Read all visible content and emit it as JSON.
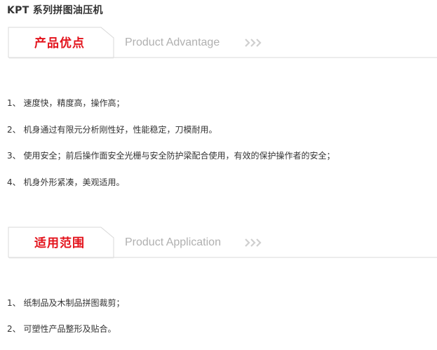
{
  "page": {
    "title": "KPT 系列拼图油压机"
  },
  "sections": [
    {
      "title_cn": "产品优点",
      "title_en": "Product Advantage",
      "items": [
        "1、 速度快，精度高，操作高；",
        "2、 机身通过有限元分析刚性好，性能稳定，刀模耐用。",
        "3、 使用安全；前后操作面安全光栅与安全防护梁配合使用，有效的保护操作者的安全；",
        "4、 机身外形紧凑，美观适用。"
      ]
    },
    {
      "title_cn": "适用范围",
      "title_en": "Product Application",
      "items": [
        "1、 纸制品及木制品拼图裁剪；",
        "2、 可塑性产品整形及贴合。"
      ]
    }
  ],
  "colors": {
    "accent_red": "#e3121b",
    "english_title": "#b0b0b0",
    "arrow_gray": "#cfcfcf",
    "line_gray": "#d8d8d8",
    "text": "#333333"
  },
  "icons": {
    "section_arrows": "triple-chevron-right-icon"
  }
}
